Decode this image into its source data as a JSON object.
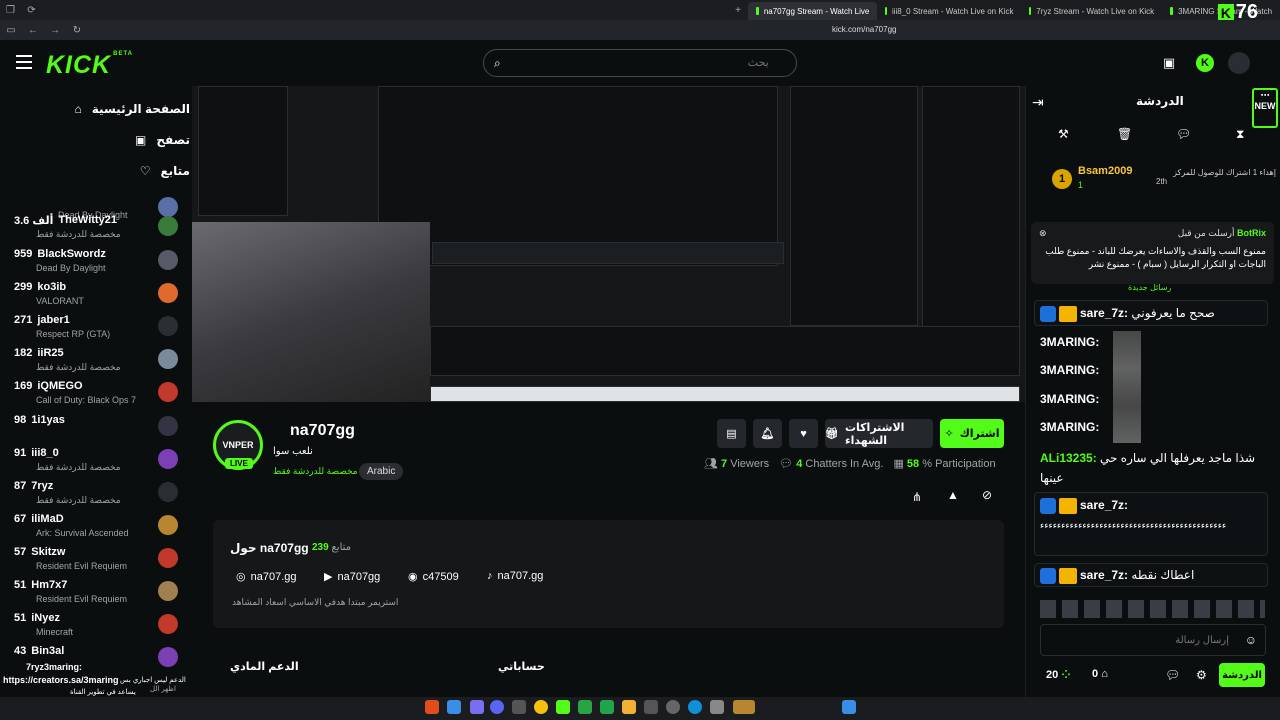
{
  "browser": {
    "tabs": [
      {
        "label": "na707gg Stream - Watch Live",
        "active": true
      },
      {
        "label": "iii8_0 Stream - Watch Live on Kick",
        "active": false
      },
      {
        "label": "7ryz Stream - Watch Live on Kick",
        "active": false
      },
      {
        "label": "3MARING Stream - Watch",
        "active": false
      }
    ],
    "url": "kick.com/na707gg",
    "corner_count": "76"
  },
  "header": {
    "logo": "KICK",
    "logo_badge": "BETA",
    "search_placeholder": "بحث"
  },
  "sidebar": {
    "nav": [
      {
        "label": "الصفحة الرئيسية",
        "icon": "home-icon"
      },
      {
        "label": "تصفح",
        "icon": "browse-icon"
      },
      {
        "label": "متابع",
        "icon": "heart-icon"
      }
    ],
    "channels": [
      {
        "name": "",
        "viewers": "",
        "game": "Dead By Daylight"
      },
      {
        "name": "TheWitty21",
        "viewers": "3.6 ألف",
        "game": "مخصصة للدردشة فقط"
      },
      {
        "name": "BlackSwordz",
        "viewers": "959",
        "game": "Dead By Daylight"
      },
      {
        "name": "ko3ib",
        "viewers": "299",
        "game": "VALORANT"
      },
      {
        "name": "jaber1",
        "viewers": "271",
        "game": "Respect RP (GTA)"
      },
      {
        "name": "iiR25",
        "viewers": "182",
        "game": "مخصصة للدردشة فقط"
      },
      {
        "name": "iQMEGO",
        "viewers": "169",
        "game": "Call of Duty: Black Ops 7"
      },
      {
        "name": "1i1yas",
        "viewers": "98",
        "game": ""
      },
      {
        "name": "iii8_0",
        "viewers": "91",
        "game": "مخصصة للدردشة فقط"
      },
      {
        "name": "7ryz",
        "viewers": "87",
        "game": "مخصصة للدردشة فقط"
      },
      {
        "name": "iliMaD",
        "viewers": "67",
        "game": "Ark: Survival Ascended"
      },
      {
        "name": "Skitzw",
        "viewers": "57",
        "game": "Resident Evil Requiem"
      },
      {
        "name": "Hm7x7",
        "viewers": "51",
        "game": "Resident Evil Requiem"
      },
      {
        "name": "iNyez",
        "viewers": "51",
        "game": "Minecraft"
      },
      {
        "name": "Bin3al",
        "viewers": "43",
        "game": ""
      }
    ],
    "overlay_lines": [
      "7ryz3maring:",
      "الدعم ليس اجباري بس",
      "https://creators.sa/3maring",
      "يساعد في تطوير القناة",
      "اظهر الل"
    ]
  },
  "stream": {
    "channel": "na707gg",
    "title": "نلعب سوا",
    "category": "مخصصة للدردشة فقط",
    "tag": "Arabic",
    "live": "LIVE",
    "avatar_text": "VNPER",
    "viewers": "7",
    "viewers_label": "Viewers",
    "chatters": "4",
    "chatters_label": "Chatters In Avg.",
    "participation": "58",
    "participation_label": "% Participation",
    "subscribe_label": "اشتراك",
    "gift_label": "الاشتراكات الشهداء"
  },
  "about": {
    "title": "حول na707gg",
    "followers": "239",
    "followers_label": "متابع",
    "socials": [
      {
        "icon": "instagram-icon",
        "label": "na707.gg"
      },
      {
        "icon": "youtube-icon",
        "label": "na707gg"
      },
      {
        "icon": "discord-icon",
        "label": "c47509"
      },
      {
        "icon": "tiktok-icon",
        "label": "na707.gg"
      }
    ],
    "bio": "استريمر مبتدا هدفي الاساسي اسعاد المشاهد"
  },
  "sections": {
    "support": "الدعم المادي",
    "accounts": "حساباتي"
  },
  "chat": {
    "title": "الدردشة",
    "new_label": "NEW",
    "top_sub": {
      "rank": "1",
      "user": "Bsam2009",
      "count": "1",
      "text": "إهداء 1 اشتراك للوصول للمركز",
      "place": "2th"
    },
    "pinned": {
      "author": "BotRix",
      "header": "أرسلت من قبل",
      "text": "ممنوع السب والقذف والاساءات يعرضك للباند - ممنوع طلب الباجات او التكرار الرسايل ( سبام ) - ممنوع نشر"
    },
    "new_messages": "رسائل جديدة",
    "messages": [
      {
        "user": "sare_7z:",
        "text": "صحح ما يعرفوني"
      },
      {
        "user": "3MARING:",
        "text": ""
      },
      {
        "user": "3MARING:",
        "text": ""
      },
      {
        "user": "3MARING:",
        "text": ""
      },
      {
        "user": "3MARING:",
        "text": ""
      },
      {
        "user": "ALi13235:",
        "text": "شذا ماجد يعرفلها الي ساره حي عينها"
      },
      {
        "user": "sare_7z:",
        "text": "ءءءءءءءءءءءءءءءءءءءءءءءءءءءءءءءءءءءءءءءءءءءء"
      },
      {
        "user": "sare_7z:",
        "text": "اعطاك نقطه"
      }
    ],
    "input_placeholder": "إرسال رسالة",
    "points": "20",
    "gift_count": "0",
    "send_label": "الدردشة"
  },
  "colors": {
    "accent": "#53fc18",
    "bg": "#0b0e0f",
    "panel": "#151719"
  }
}
